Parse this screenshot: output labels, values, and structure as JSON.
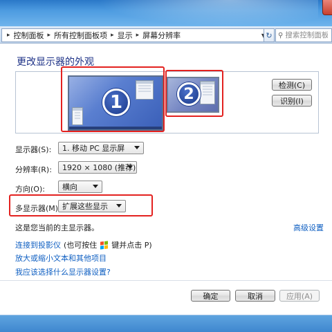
{
  "address_bar": {
    "crumbs": [
      "控制面板",
      "所有控制面板项",
      "显示",
      "屏幕分辨率"
    ],
    "search_placeholder": "搜索控制面板"
  },
  "page": {
    "heading": "更改显示器的外观"
  },
  "monitor_preview": {
    "monitor1_number": "1",
    "monitor2_number": "2"
  },
  "buttons": {
    "detect": "检测(C)",
    "identify": "识别(I)",
    "ok": "确定",
    "cancel": "取消",
    "apply": "应用(A)"
  },
  "settings": {
    "display_label": "显示器(S):",
    "display_value": "1. 移动 PC 显示屏",
    "resolution_label": "分辨率(R):",
    "resolution_value": "1920 × 1080 (推荐)",
    "orientation_label": "方向(O):",
    "orientation_value": "横向",
    "multi_display_label": "多显示器(M):",
    "multi_display_value": "扩展这些显示"
  },
  "info": {
    "primary_display_text": "这是您当前的主显示器。",
    "advanced_settings_link": "高级设置"
  },
  "links": {
    "connect_projector": "连接到投影仪",
    "connect_projector_hint_pre": "(也可按住",
    "connect_projector_hint_post": "键并点击 P)",
    "text_size": "放大或缩小文本和其他项目",
    "which_settings": "我应该选择什么显示器设置?"
  },
  "colors": {
    "highlight": "#e3211f",
    "link": "#0f5fc2",
    "heading": "#1e3287",
    "win_logo": [
      "#f25022",
      "#7fba00",
      "#00a4ef",
      "#ffb900"
    ]
  }
}
